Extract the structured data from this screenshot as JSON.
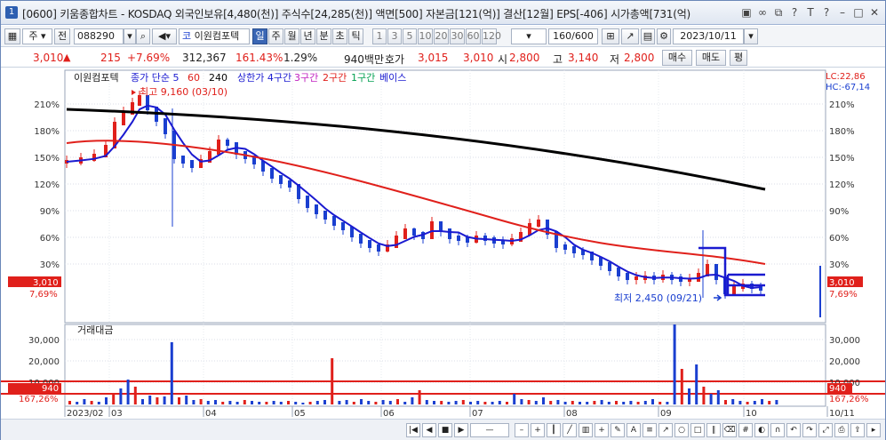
{
  "window": {
    "number": "1",
    "title": "[0600] 키움종합차트 - KOSDAQ 외국인보유[4,480(천)] 주식수[24,285(천)] 액면[500] 자본금[121(억)] 결산[12월] EPS[-406] 시가총액[731(억)",
    "icons": [
      "image-icon",
      "link-icon",
      "window-icon",
      "help-icon",
      "text-icon",
      "pin-icon",
      "minimize-icon",
      "maximize-icon",
      "close-icon"
    ]
  },
  "toolbar": {
    "type_select": "주",
    "prev_label": "전",
    "code": "088290",
    "stock_name": "이원컴포텍",
    "periods": [
      "일",
      "주",
      "월",
      "년",
      "분",
      "초",
      "틱"
    ],
    "active_period": "일",
    "minutes": [
      "1",
      "3",
      "5",
      "10",
      "20",
      "30",
      "60",
      "120"
    ],
    "count": "160",
    "count_total": "/600",
    "date": "2023/10/11"
  },
  "info": {
    "price": "3,010",
    "up_arrow": "▲",
    "change": "215",
    "change_pct": "+7.69%",
    "volume": "312,367",
    "vol_ratio": "161.43%",
    "turnover": "1.29%",
    "amount": "940백만",
    "quote_label": "호가",
    "ask": "3,015",
    "bid": "3,010",
    "open_label": "시",
    "open": "2,800",
    "high_label": "고",
    "high": "3,140",
    "low_label": "저",
    "low": "2,800",
    "buy": "매수",
    "sell": "매도",
    "flat": "평"
  },
  "chart": {
    "legend_name": "이원컴포텍",
    "legend_items": [
      {
        "text": "종가 단순 5",
        "color": "#1a1ad0"
      },
      {
        "text": "60",
        "color": "#e0201b"
      },
      {
        "text": "240",
        "color": "#000000"
      },
      {
        "text": "상한가 4구간",
        "color": "#1a1ad0"
      },
      {
        "text": "3구간",
        "color": "#c020c0"
      },
      {
        "text": "2구간",
        "color": "#e0201b"
      },
      {
        "text": "1구간",
        "color": "#00a050"
      },
      {
        "text": "베이스",
        "color": "#1a1ad0"
      }
    ],
    "lc": "LC:22,86",
    "hc": "HC:-67,14",
    "y_ticks": [
      "210%",
      "180%",
      "150%",
      "120%",
      "90%",
      "60%",
      "30%"
    ],
    "price_tag": "3,010",
    "pct_tag": "7,69%",
    "high_note": "최고 9,160 (03/10)",
    "low_note": "최저 2,450 (09/21)",
    "volume_title": "거래대금",
    "vol_ticks": [
      "30,000",
      "20,000",
      "10,000"
    ],
    "vol_tag": "940",
    "vol_pct_tag": "167,26%",
    "x_labels": [
      "2023/02",
      "03",
      "04",
      "05",
      "06",
      "07",
      "08",
      "09",
      "10",
      "10/11"
    ],
    "colors": {
      "up": "#e0201b",
      "down": "#1a3fd0",
      "ma5": "#1a1ad0",
      "ma60": "#e0201b",
      "ma240": "#000000"
    }
  }
}
